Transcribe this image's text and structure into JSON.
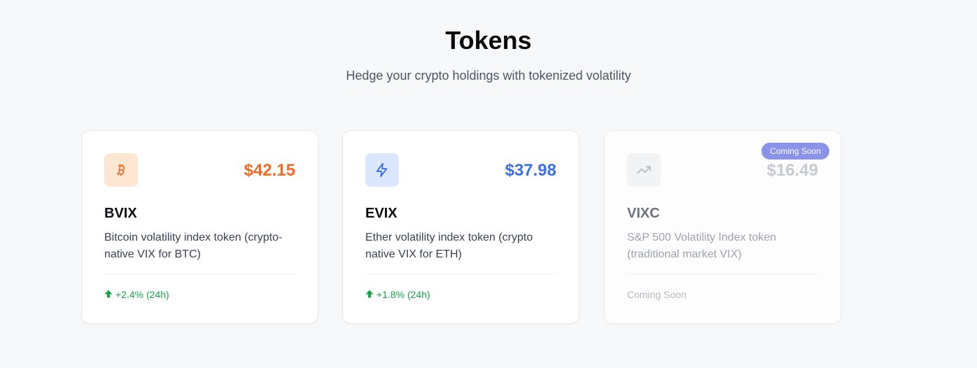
{
  "header": {
    "title": "Tokens",
    "subtitle": "Hedge your crypto holdings with tokenized volatility"
  },
  "tokens": [
    {
      "symbol": "BVIX",
      "price": "$42.15",
      "description": "Bitcoin volatility index token (crypto-native VIX for BTC)",
      "change": "+2.4% (24h)",
      "icon": "bitcoin-icon",
      "accent_color": "#f06b24",
      "icon_bg": "#fde7d3",
      "status": "active"
    },
    {
      "symbol": "EVIX",
      "price": "$37.98",
      "description": "Ether volatility index token (crypto native VIX for ETH)",
      "change": "+1.8% (24h)",
      "icon": "lightning-icon",
      "accent_color": "#3b6fe6",
      "icon_bg": "#dbe7fe",
      "status": "active"
    },
    {
      "symbol": "VIXC",
      "price": "$16.49",
      "description": "S&P 500 Volatility Index token (traditional market VIX)",
      "change": "Coming Soon",
      "badge": "Coming Soon",
      "icon": "trending-up-icon",
      "accent_color": "#c5c9d1",
      "icon_bg": "#f2f3f5",
      "status": "coming-soon"
    }
  ],
  "colors": {
    "positive": "#16a34a",
    "badge_bg": "#8b93e8",
    "page_bg": "#f7f8fa"
  }
}
